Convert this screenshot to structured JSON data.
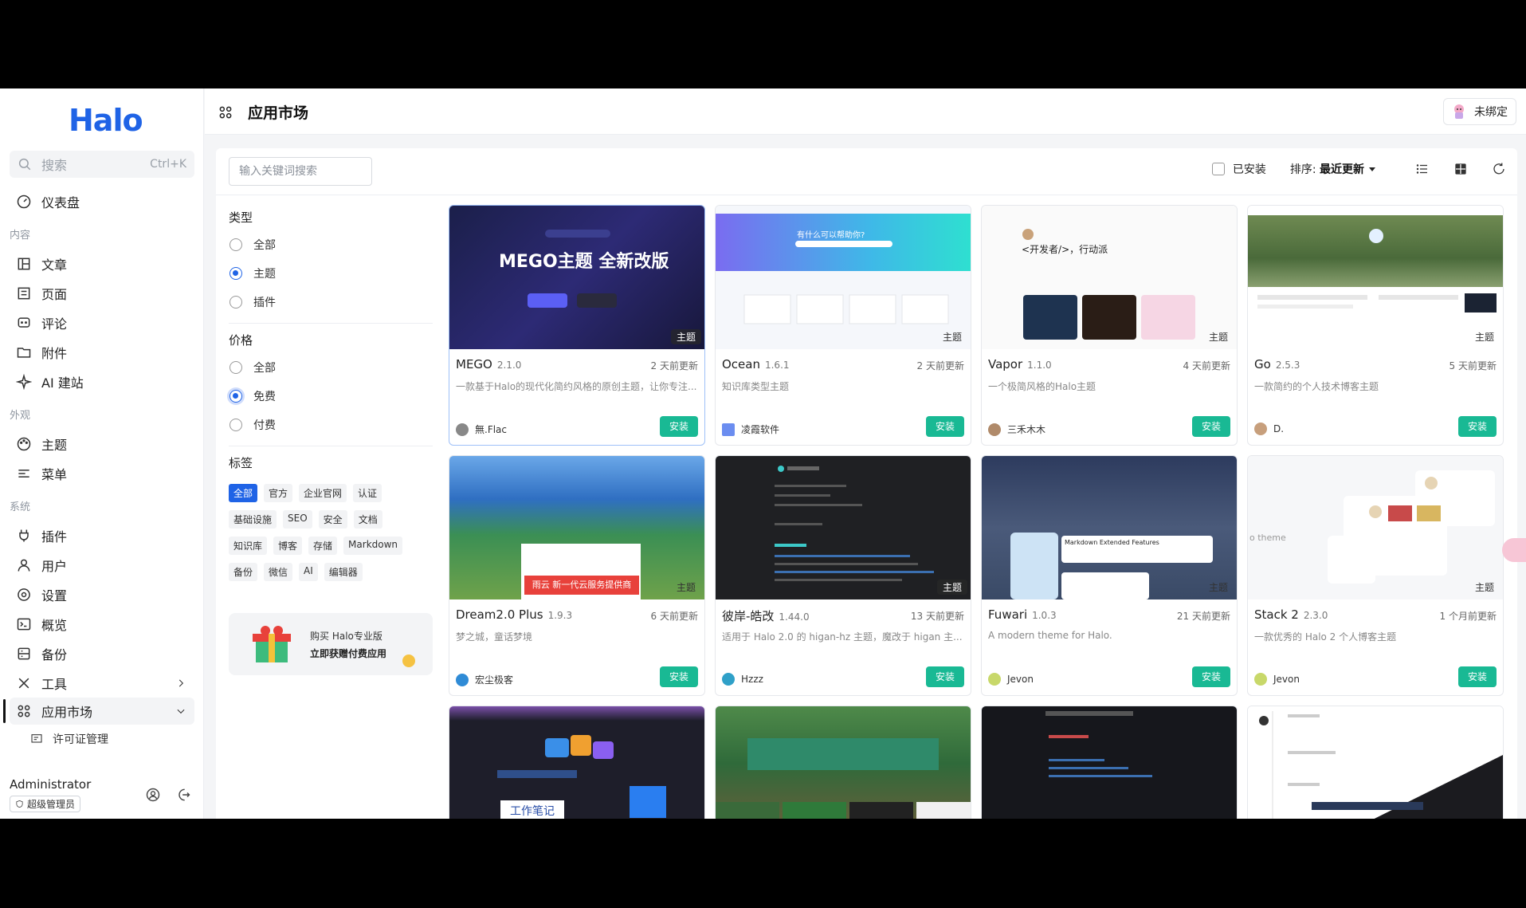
{
  "sidebar": {
    "logo": "Halo",
    "search_label": "搜索",
    "search_kbd": "Ctrl+K",
    "dashboard": "仪表盘",
    "group_content": "内容",
    "posts": "文章",
    "pages": "页面",
    "comments": "评论",
    "attachments": "附件",
    "ai": "AI 建站",
    "group_appearance": "外观",
    "themes": "主题",
    "menus": "菜单",
    "group_system": "系统",
    "plugins": "插件",
    "users": "用户",
    "settings": "设置",
    "overview": "概览",
    "backup": "备份",
    "tools": "工具",
    "market": "应用市场",
    "license": "许可证管理",
    "user_name": "Administrator",
    "user_role": "超级管理员"
  },
  "header": {
    "title": "应用市场",
    "unbound": "未绑定"
  },
  "toolbar": {
    "search_placeholder": "输入关键词搜索",
    "installed_label": "已安装",
    "sort_label": "排序:",
    "sort_value": "最近更新"
  },
  "filters": {
    "type_title": "类型",
    "type_options": [
      "全部",
      "主题",
      "插件"
    ],
    "price_title": "价格",
    "price_options": [
      "全部",
      "免费",
      "付费"
    ],
    "tags_title": "标签",
    "tags": [
      "全部",
      "官方",
      "企业官网",
      "认证",
      "基础设施",
      "SEO",
      "安全",
      "文档",
      "知识库",
      "博客",
      "存储",
      "Markdown",
      "备份",
      "微信",
      "AI",
      "编辑器"
    ],
    "promo_line1": "购买 Halo专业版",
    "promo_line2": "立即获赠付费应用"
  },
  "cards": [
    {
      "name": "MEGO",
      "version": "2.1.0",
      "updated": "2 天前更新",
      "desc": "一款基于Halo的现代化简约风格的原创主题，让你专注...",
      "author": "無.Flac",
      "badge": "主题",
      "install": "安装",
      "thumb_text": "MEGO主题 全新改版"
    },
    {
      "name": "Ocean",
      "version": "1.6.1",
      "updated": "2 天前更新",
      "desc": "知识库类型主题",
      "author": "凌霞软件",
      "badge": "主题",
      "install": "安装",
      "thumb_text": "有什么可以帮助你?"
    },
    {
      "name": "Vapor",
      "version": "1.1.0",
      "updated": "4 天前更新",
      "desc": "一个极简风格的Halo主题",
      "author": "三禾木木",
      "badge": "主题",
      "install": "安装",
      "thumb_text": "<开发者/>，行动派"
    },
    {
      "name": "Go",
      "version": "2.5.3",
      "updated": "5 天前更新",
      "desc": "一款简约的个人技术博客主题",
      "author": "D.",
      "badge": "主题",
      "install": "安装",
      "thumb_text": ""
    },
    {
      "name": "Dream2.0 Plus",
      "version": "1.9.3",
      "updated": "6 天前更新",
      "desc": "梦之城，童话梦境",
      "author": "宏尘极客",
      "badge": "主题",
      "install": "安装",
      "thumb_text": "雨云 新一代云服务提供商"
    },
    {
      "name": "彼岸-皓改",
      "version": "1.44.0",
      "updated": "13 天前更新",
      "desc": "适用于 Halo 2.0 的 higan-hz 主题，魔改于 higan 主...",
      "author": "Hzzz",
      "badge": "主题",
      "install": "安装",
      "thumb_text": ""
    },
    {
      "name": "Fuwari",
      "version": "1.0.3",
      "updated": "21 天前更新",
      "desc": "A modern theme for Halo.",
      "author": "Jevon",
      "badge": "主题",
      "install": "安装",
      "thumb_text": "Markdown Extended Features"
    },
    {
      "name": "Stack 2",
      "version": "2.3.0",
      "updated": "1 个月前更新",
      "desc": "一款优秀的 Halo 2 个人博客主题",
      "author": "Jevon",
      "badge": "主题",
      "install": "安装",
      "thumb_text": "o theme"
    },
    {
      "name": "",
      "version": "",
      "updated": "",
      "desc": "",
      "author": "",
      "badge": "",
      "install": "",
      "thumb_text": "工作笔记"
    },
    {
      "name": "",
      "version": "",
      "updated": "",
      "desc": "",
      "author": "",
      "badge": "",
      "install": "",
      "thumb_text": ""
    },
    {
      "name": "",
      "version": "",
      "updated": "",
      "desc": "",
      "author": "",
      "badge": "",
      "install": "",
      "thumb_text": ""
    },
    {
      "name": "",
      "version": "",
      "updated": "",
      "desc": "",
      "author": "",
      "badge": "",
      "install": "",
      "thumb_text": ""
    }
  ],
  "colors": {
    "primary": "#1f63e6",
    "install": "#19b994"
  }
}
